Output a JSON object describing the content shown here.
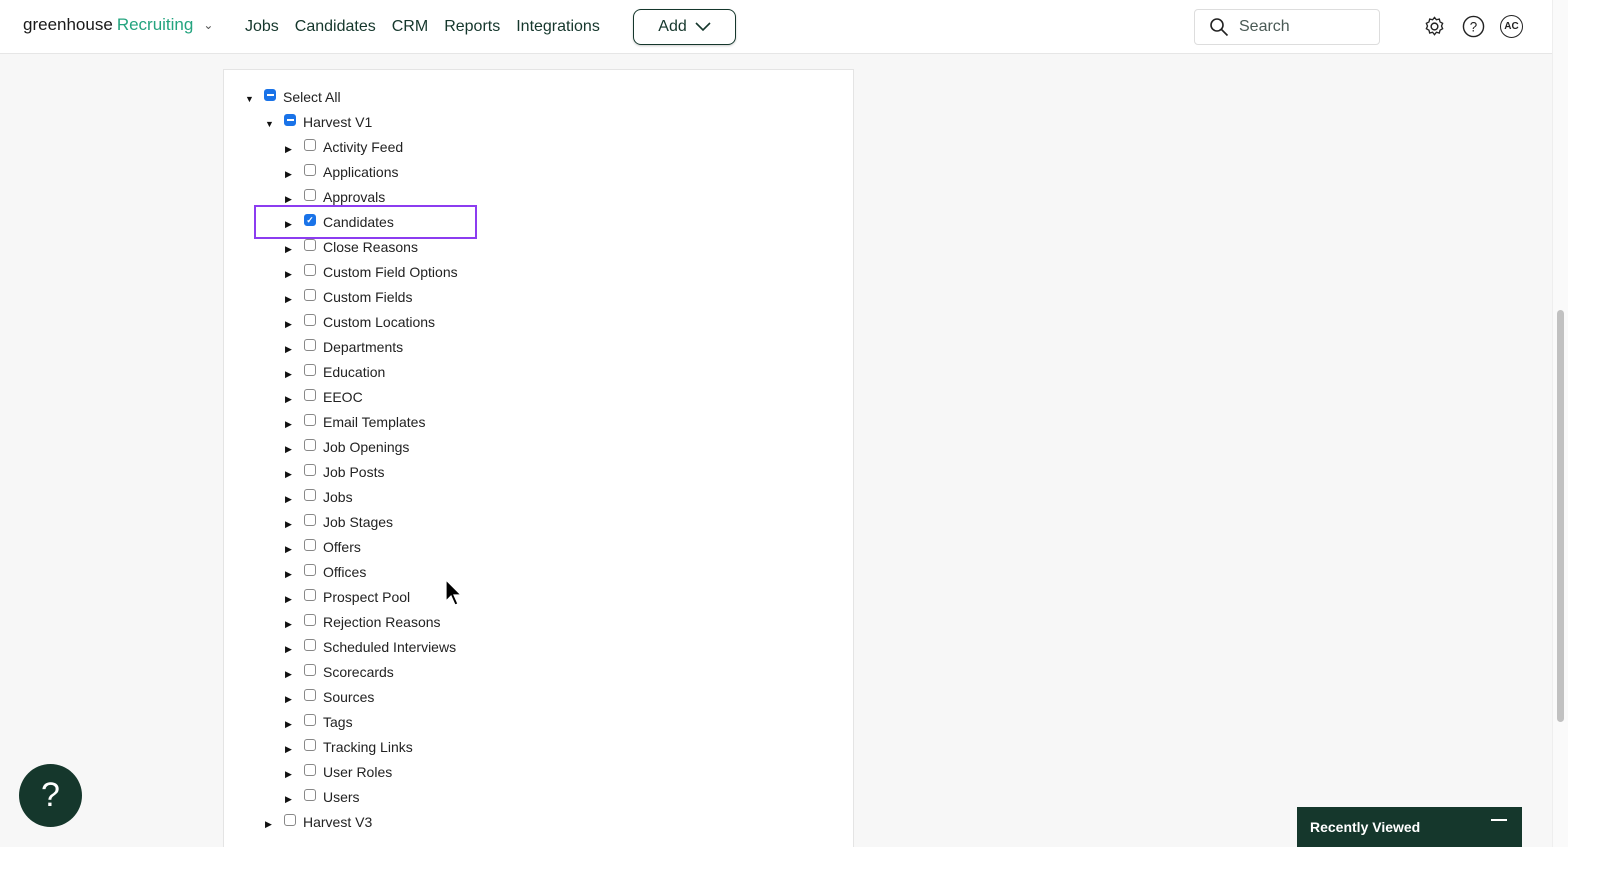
{
  "header": {
    "logo_main": "greenhouse",
    "logo_product": "Recruiting",
    "nav": [
      "Jobs",
      "Candidates",
      "CRM",
      "Reports",
      "Integrations"
    ],
    "add_label": "Add",
    "search_placeholder": "Search",
    "avatar_initials": "AC"
  },
  "tree": {
    "select_all": {
      "label": "Select All",
      "state": "indeterminate"
    },
    "harvest_v1": {
      "label": "Harvest V1",
      "state": "indeterminate"
    },
    "items": [
      {
        "label": "Activity Feed",
        "checked": false
      },
      {
        "label": "Applications",
        "checked": false
      },
      {
        "label": "Approvals",
        "checked": false
      },
      {
        "label": "Candidates",
        "checked": true
      },
      {
        "label": "Close Reasons",
        "checked": false
      },
      {
        "label": "Custom Field Options",
        "checked": false
      },
      {
        "label": "Custom Fields",
        "checked": false
      },
      {
        "label": "Custom Locations",
        "checked": false
      },
      {
        "label": "Departments",
        "checked": false
      },
      {
        "label": "Education",
        "checked": false
      },
      {
        "label": "EEOC",
        "checked": false
      },
      {
        "label": "Email Templates",
        "checked": false
      },
      {
        "label": "Job Openings",
        "checked": false
      },
      {
        "label": "Job Posts",
        "checked": false
      },
      {
        "label": "Jobs",
        "checked": false
      },
      {
        "label": "Job Stages",
        "checked": false
      },
      {
        "label": "Offers",
        "checked": false
      },
      {
        "label": "Offices",
        "checked": false
      },
      {
        "label": "Prospect Pool",
        "checked": false
      },
      {
        "label": "Rejection Reasons",
        "checked": false
      },
      {
        "label": "Scheduled Interviews",
        "checked": false
      },
      {
        "label": "Scorecards",
        "checked": false
      },
      {
        "label": "Sources",
        "checked": false
      },
      {
        "label": "Tags",
        "checked": false
      },
      {
        "label": "Tracking Links",
        "checked": false
      },
      {
        "label": "User Roles",
        "checked": false
      },
      {
        "label": "Users",
        "checked": false
      }
    ],
    "harvest_v3": {
      "label": "Harvest V3",
      "state": "unchecked"
    }
  },
  "help_button": "?",
  "recently_viewed": "Recently Viewed",
  "colors": {
    "brand": "#15372c",
    "accent": "#24a47f",
    "highlight": "#8c3cf0",
    "checkbox": "#1a73e8"
  }
}
